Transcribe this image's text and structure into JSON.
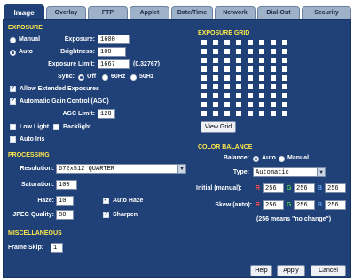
{
  "tabs": [
    {
      "label": "Image",
      "active": true
    },
    {
      "label": "Overlay",
      "active": false
    },
    {
      "label": "FTP",
      "active": false
    },
    {
      "label": "Applet",
      "active": false
    },
    {
      "label": "Date/Time",
      "active": false
    },
    {
      "label": "Network",
      "active": false
    },
    {
      "label": "Dial-Out",
      "active": false
    },
    {
      "label": "Security",
      "active": false
    }
  ],
  "exposure": {
    "title": "EXPOSURE",
    "mode_manual": "Manual",
    "mode_auto": "Auto",
    "selected_mode": "Auto",
    "exposure_label": "Exposure:",
    "exposure_value": "1600",
    "brightness_label": "Brightness:",
    "brightness_value": "100",
    "limit_label": "Exposure Limit:",
    "limit_value": "1667",
    "limit_note": "(0.32767)",
    "sync_label": "Sync:",
    "sync_off": "Off",
    "sync_60": "60Hz",
    "sync_50": "50Hz",
    "sync_selected": "Off",
    "allow_extended": "Allow Extended Exposures",
    "auto_gain": "Automatic Gain Control (AGC)",
    "agc_limit_label": "AGC Limit:",
    "agc_limit_value": "128",
    "low_light": "Low Light",
    "backlight": "Backlight",
    "auto_iris": "Auto Iris"
  },
  "exposure_grid": {
    "title": "EXPOSURE GRID",
    "rows": 9,
    "cols": 8,
    "view_button": "View Grid"
  },
  "processing": {
    "title": "PROCESSING",
    "resolution_label": "Resolution:",
    "resolution_value": "672x512 QUARTER",
    "saturation_label": "Saturation:",
    "saturation_value": "100",
    "haze_label": "Haze:",
    "haze_value": "10",
    "auto_haze": "Auto Haze",
    "jpeg_label": "JPEG Quality:",
    "jpeg_value": "80",
    "sharpen": "Sharpen"
  },
  "color_balance": {
    "title": "COLOR BALANCE",
    "balance_label": "Balance:",
    "balance_auto": "Auto",
    "balance_manual": "Manual",
    "balance_selected": "Auto",
    "type_label": "Type:",
    "type_value": "Automatic",
    "initial_label": "Initial (manual):",
    "initial_r": "256",
    "initial_g": "256",
    "initial_b": "256",
    "skew_label": "Skew (auto):",
    "skew_r": "256",
    "skew_g": "256",
    "skew_b": "256",
    "letter_r": "R",
    "letter_g": "G",
    "letter_b": "B",
    "note": "(256 means \"no change\")",
    "color_r": "#ff4a4a",
    "color_g": "#4ad94a",
    "color_b": "#6aa8ff"
  },
  "misc": {
    "title": "MISCELLANEOUS",
    "frame_skip_label": "Frame Skip:",
    "frame_skip_value": "1"
  },
  "buttons": {
    "help": "Help",
    "apply": "Apply",
    "cancel": "Cancel"
  },
  "colors": {
    "panel": "#1f4177",
    "section_heading": "#ffe84a",
    "tab_inactive": "#9db1c8"
  }
}
